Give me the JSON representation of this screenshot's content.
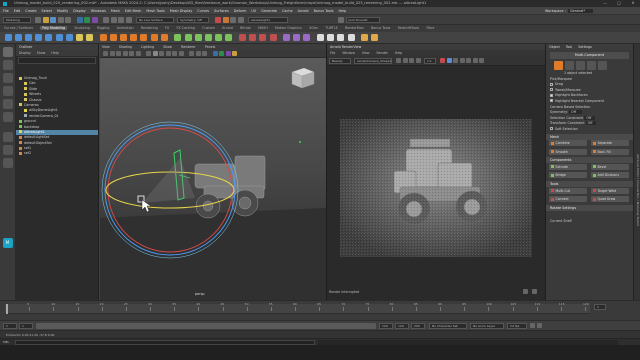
{
  "title_bar": {
    "text": "Unimog_model_build_025_rendering_002.mb* - Autodesk MAYA 2024.2: C:\\Users\\joshy\\Desktop\\VID_files\\freelance_work\\Gnomon_Workshop\\Unimog_Freightliner\\maya\\Unimog_model_build_025_rendering_002.mb --- aiAreaLight1",
    "min": "—",
    "max": "□",
    "close": "✕"
  },
  "menubar": {
    "items": [
      "File",
      "Edit",
      "Create",
      "Select",
      "Modify",
      "Display",
      "Windows",
      "Mesh",
      "Edit Mesh",
      "Mesh Tools",
      "Mesh Display",
      "Curves",
      "Surfaces",
      "Deform",
      "UV",
      "Generate",
      "Cache",
      "Arnold",
      "Bonus Tools",
      "Help"
    ],
    "workspace_label": "Workspace :",
    "workspace_value": "General*"
  },
  "status_line": {
    "menu_set": "Modeling",
    "no_live_surface": "No Live Surface",
    "symmetry": "Symmetry: Off",
    "renderable_camera": "aiAreaLight1",
    "user": "Josh Doucett"
  },
  "shelf_tabs": [
    "Curves / Surfaces",
    "Poly Modeling",
    "Sculpting",
    "Rigging",
    "Animation",
    "Rendering",
    "FX",
    "FX Caching",
    "Custom",
    "Arnold",
    "Bifrost",
    "MASH",
    "Motion Graphics",
    "XGen",
    "TURTLE",
    "RenderMan",
    "Bonus Tools",
    "RedshiftTools",
    "Fibre"
  ],
  "shelf_active": "Poly Modeling",
  "outliner": {
    "title": "Outliner",
    "menu": [
      "Display",
      "Show",
      "Help"
    ],
    "items": [
      {
        "label": "Unimog_Truck",
        "depth": 0,
        "type": "group"
      },
      {
        "label": "Cab",
        "depth": 1,
        "type": "group"
      },
      {
        "label": "Slide",
        "depth": 1,
        "type": "group"
      },
      {
        "label": "Wheels",
        "depth": 1,
        "type": "group"
      },
      {
        "label": "Chassis",
        "depth": 1,
        "type": "group"
      },
      {
        "label": "Cameras",
        "depth": 0,
        "type": "group"
      },
      {
        "label": "aiSkyDomeLight1",
        "depth": 1,
        "type": "light"
      },
      {
        "label": "renderCamera_01",
        "depth": 1,
        "type": "camera"
      },
      {
        "label": "ground",
        "depth": 0,
        "type": "mesh"
      },
      {
        "label": "backdrop",
        "depth": 0,
        "type": "mesh"
      },
      {
        "label": "aiAreaLight1",
        "depth": 0,
        "type": "light",
        "selected": true
      },
      {
        "label": "defaultLightSet",
        "depth": 0,
        "type": "set"
      },
      {
        "label": "defaultObjectSet",
        "depth": 0,
        "type": "set"
      },
      {
        "label": "set1",
        "depth": 0,
        "type": "set"
      },
      {
        "label": "set2",
        "depth": 0,
        "type": "set"
      }
    ]
  },
  "viewport": {
    "menu": [
      "View",
      "Shading",
      "Lighting",
      "Show",
      "Renderer",
      "Panels"
    ],
    "camera_label": "persp",
    "symmetry_button_colors": [
      "#3a6ea5",
      "#2d8c4e",
      "#7a4ca8",
      "#c7a03a"
    ]
  },
  "arnold_render_view": {
    "title": "Arnold RenderView",
    "menu": [
      "File",
      "Window",
      "View",
      "Render",
      "Help"
    ],
    "pass": "Beauty",
    "camera": "renderCamera_Shape1",
    "zoom": "1:1",
    "status": "Render interrupted"
  },
  "attribute_editor": {
    "tabs": [
      "Object",
      "Tool",
      "Settings"
    ],
    "tool_title": "Multi-Component",
    "selected_count": "1 object selected",
    "pick_walk_header": "Pick/Marquee",
    "options": [
      {
        "label": "Drag",
        "checked": false
      },
      {
        "label": "Tweak/Marquee",
        "checked": false
      },
      {
        "label": "Highlight Backfaces",
        "checked": true
      },
      {
        "label": "Highlight Nearest Component",
        "checked": true
      }
    ],
    "camera_based_selection": "Camera Based Selection",
    "symmetry": "Symmetry:",
    "symmetry_value": "Off",
    "selection_constraint": "Selection Constraint",
    "selection_constraint_value": "Off",
    "transform_constraint": "Transform Constraint",
    "transform_constraint_value": "Off",
    "soft_selection": "Soft Selection",
    "sections": [
      {
        "title": "Mesh",
        "buttons": [
          "Combine",
          "Separate",
          "Smooth",
          "Bool. Fill"
        ]
      },
      {
        "title": "Components",
        "buttons": [
          "Extrude",
          "Bevel",
          "Bridge",
          "Add Divisions"
        ]
      },
      {
        "title": "Tools",
        "buttons": [
          "Multi-Cut",
          "Target Weld",
          "Connect",
          "Quad Draw"
        ]
      }
    ],
    "footer_rows": [
      "Rotate Settings",
      "Current Shelf"
    ]
  },
  "side_tab": "Attribute Editor / Channel Box / Modeling Toolkit",
  "timeline": {
    "ticks": [
      5,
      10,
      15,
      20,
      25,
      30,
      35,
      40,
      45,
      50,
      55,
      60,
      65,
      70,
      75,
      80,
      85,
      90,
      95,
      100,
      105,
      110,
      115,
      120
    ],
    "current_frame": "1"
  },
  "range_bar": {
    "start": "1",
    "start_inner": "1",
    "end_inner": "120",
    "end": "120",
    "end_max": "200",
    "character_set": "No Character Set",
    "anim_layer": "No Anim Layer",
    "fps": "24 fps"
  },
  "status_bar": {
    "text": "Protractor 0.00   21.20   -37.8 0.00"
  },
  "mel": {
    "label": "MEL"
  },
  "colors": {
    "selection_blue": "#5285a6",
    "maya_orange": "#e07b2a",
    "light_green": "#3ad26a",
    "ring_yellow": "#e8d64a",
    "ring_blue": "#4aa0ff",
    "ring_red": "#d94a4a"
  }
}
